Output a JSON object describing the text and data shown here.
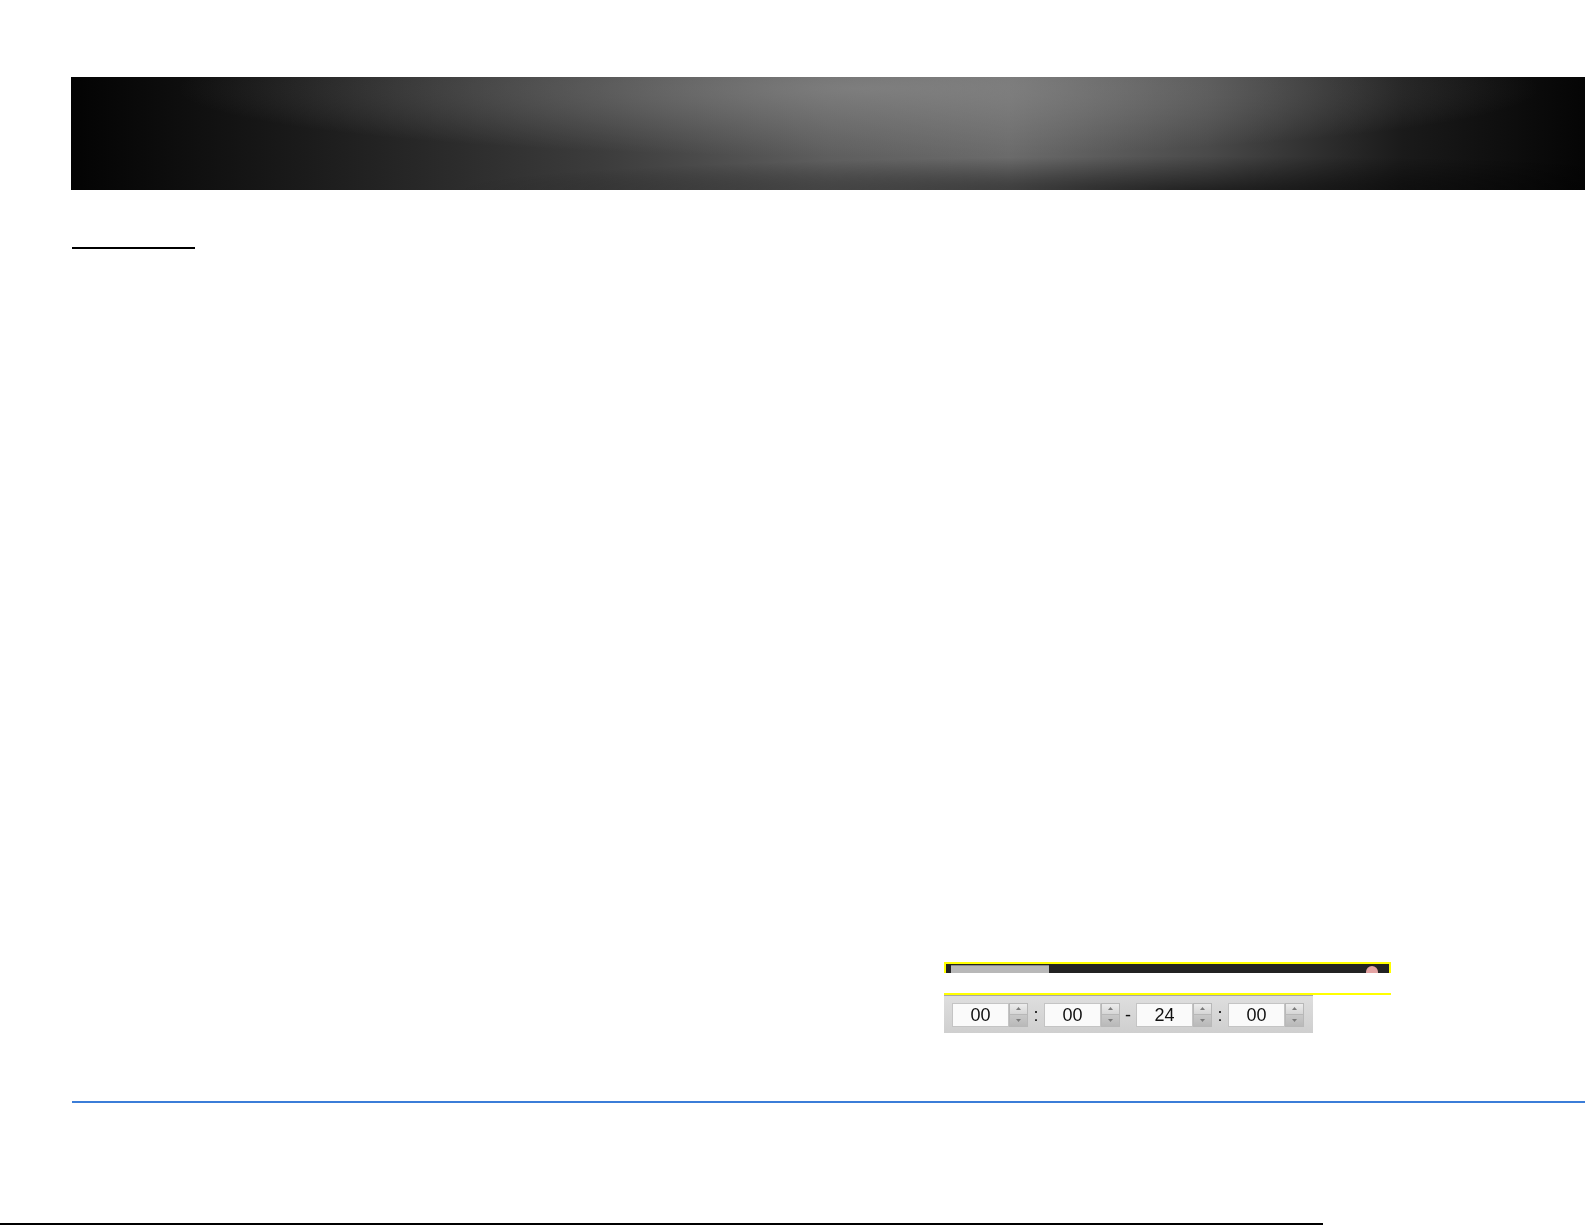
{
  "time_range": {
    "fields": [
      {
        "value": "00"
      },
      {
        "value": "00"
      },
      {
        "value": "24"
      },
      {
        "value": "00"
      }
    ],
    "separators": [
      ":",
      "-",
      ":"
    ]
  }
}
